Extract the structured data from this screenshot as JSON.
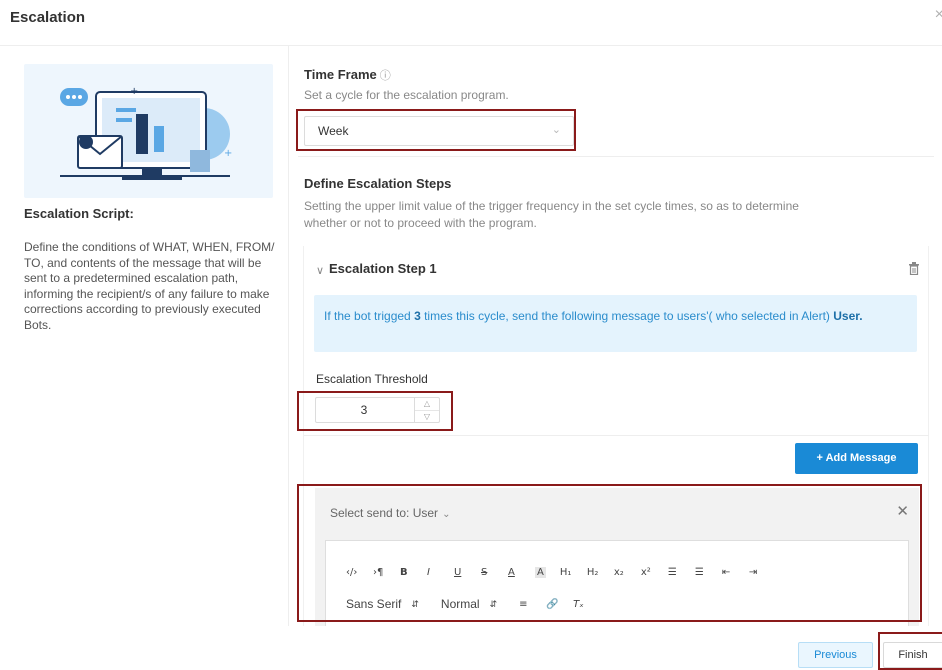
{
  "dialog": {
    "title": "Escalation",
    "close_glyph": "×"
  },
  "left": {
    "script_title": "Escalation Script:",
    "script_desc": "Define the conditions of WHAT, WHEN, FROM/ TO, and contents of the message that will be sent to a predetermined escalation path, informing the recipient/s of any failure to make corrections according to previously executed Bots."
  },
  "time_frame": {
    "title": "Time Frame",
    "info_glyph": "ⓘ",
    "desc": "Set a cycle for the escalation program.",
    "value": "Week"
  },
  "steps_section": {
    "title": "Define Escalation Steps",
    "desc": "Setting the upper limit value of the trigger frequency in the set cycle times, so as to determine whether or not to proceed with the program."
  },
  "step": {
    "title": "Escalation Step  1",
    "info_pre": "If the bot trigged ",
    "info_count": "3",
    "info_mid": " times this cycle, send the following message to users'( who selected in Alert) ",
    "info_user": "User.",
    "threshold_label": "Escalation Threshold",
    "threshold_value": "3",
    "add_message_label": "+ Add Message"
  },
  "message": {
    "send_to_label": "Select send to: User",
    "toolbar_row1": [
      "‹/›",
      "›¶",
      "B",
      "I",
      "U",
      "S",
      "A",
      "A",
      "H₁",
      "H₂",
      "x₂",
      "x²",
      "☰",
      "☰",
      "⇤",
      "⇥"
    ],
    "font_select": "Sans Serif",
    "size_select": "Normal"
  },
  "footer": {
    "previous_label": "Previous",
    "finish_label": "Finish"
  },
  "colors": {
    "primary": "#1a8ad6",
    "highlight": "#8a1a1a",
    "info_bg": "#e4f3fd"
  }
}
